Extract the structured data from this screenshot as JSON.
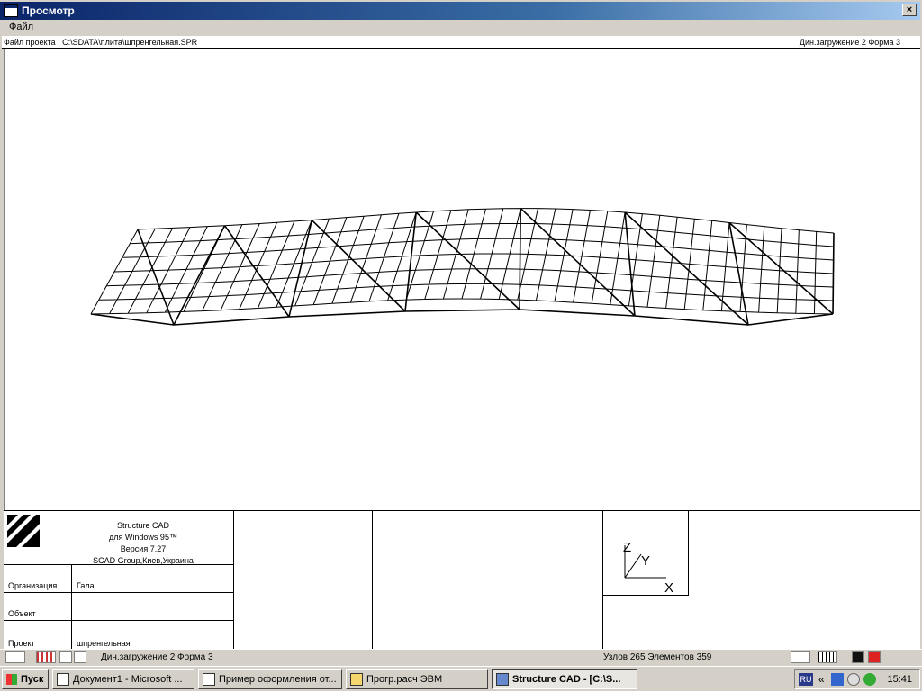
{
  "window": {
    "title": "Просмотр",
    "close_label": "×"
  },
  "menu": {
    "file_label": "Файл"
  },
  "infobar": {
    "project_file": "Файл проекта : C:\\SDATA\\плита\\шпренгельная.SPR",
    "load_case": "Дин.загружение 2  Форма 3"
  },
  "stamp": {
    "lines": [
      "Structure CAD",
      "для Windows 95™",
      "Версия 7.27",
      "SCAD Group,Киев,Украина"
    ],
    "org_label": "Организация",
    "org_value": "Гала",
    "object_label": "Объект",
    "object_value": "",
    "project_label": "Проект",
    "project_value": "шпренгельная",
    "axis_z": "Z",
    "axis_y": "Y",
    "axis_x": "X"
  },
  "statusbar": {
    "load_case": "Дин.загружение 2  Форма 3",
    "counts": "Узлов 265 Элементов 359"
  },
  "taskbar": {
    "start_label": "Пуск",
    "tasks": [
      {
        "label": "Документ1 - Microsoft ..."
      },
      {
        "label": "Пример оформления от..."
      },
      {
        "label": "Прогр.расч ЭВМ"
      },
      {
        "label": "Structure CAD  - [C:\\S..."
      }
    ],
    "lang": "RU",
    "clock": "15:41"
  }
}
